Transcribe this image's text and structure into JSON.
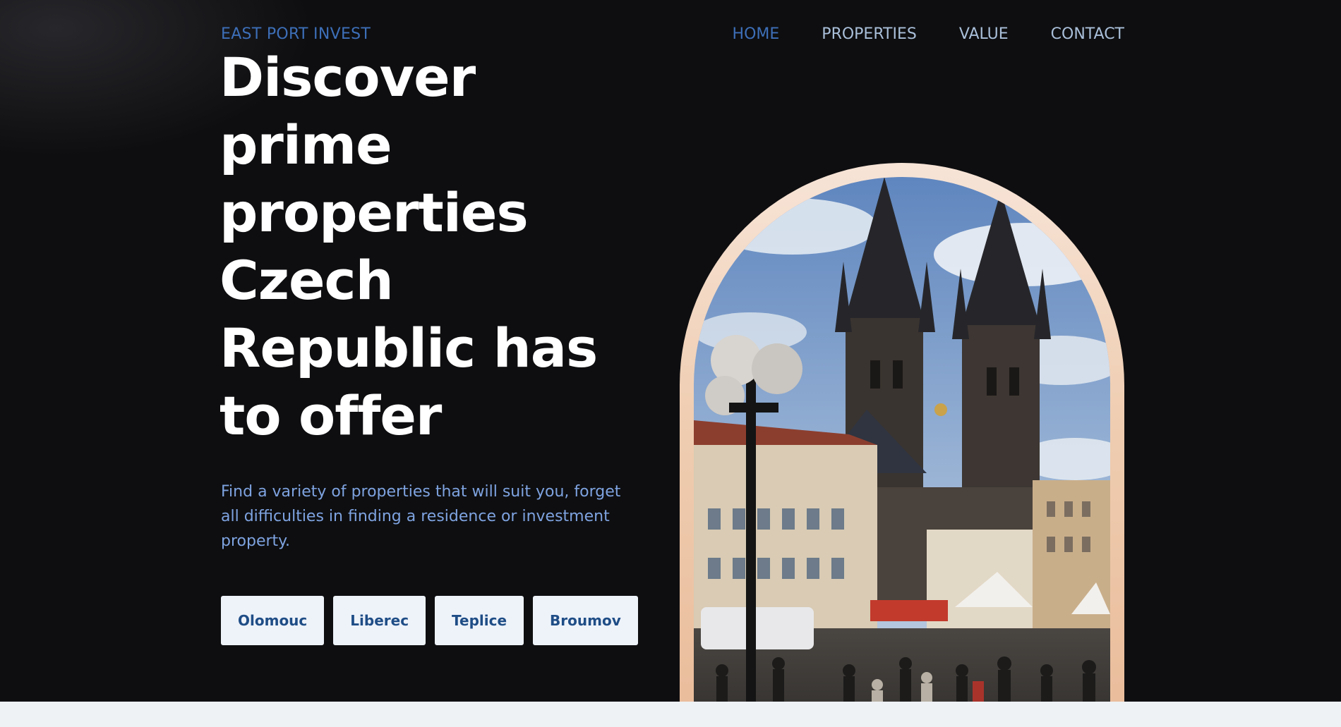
{
  "brand": {
    "name": "EAST PORT INVEST"
  },
  "nav": {
    "items": [
      {
        "label": "HOME",
        "active": true
      },
      {
        "label": "PROPERTIES",
        "active": false
      },
      {
        "label": "VALUE",
        "active": false
      },
      {
        "label": "CONTACT",
        "active": false
      }
    ]
  },
  "hero": {
    "headline": "Discover prime properties Czech Republic has to offer",
    "subtitle": "Find a variety of properties that will suit you, forget all difficulties in finding a residence or investment property.",
    "cities": [
      "Olomouc",
      "Liberec",
      "Teplice",
      "Broumov"
    ]
  },
  "colors": {
    "background": "#0e0e10",
    "accent": "#3d6fb8",
    "nav_text": "#a9bfd9",
    "subtitle_text": "#7ea3e0",
    "button_bg": "#eef3fa",
    "button_text": "#1f4d86",
    "arch_frame": "#efcdb1"
  },
  "image": {
    "subject": "old-town-square-church-photo"
  }
}
